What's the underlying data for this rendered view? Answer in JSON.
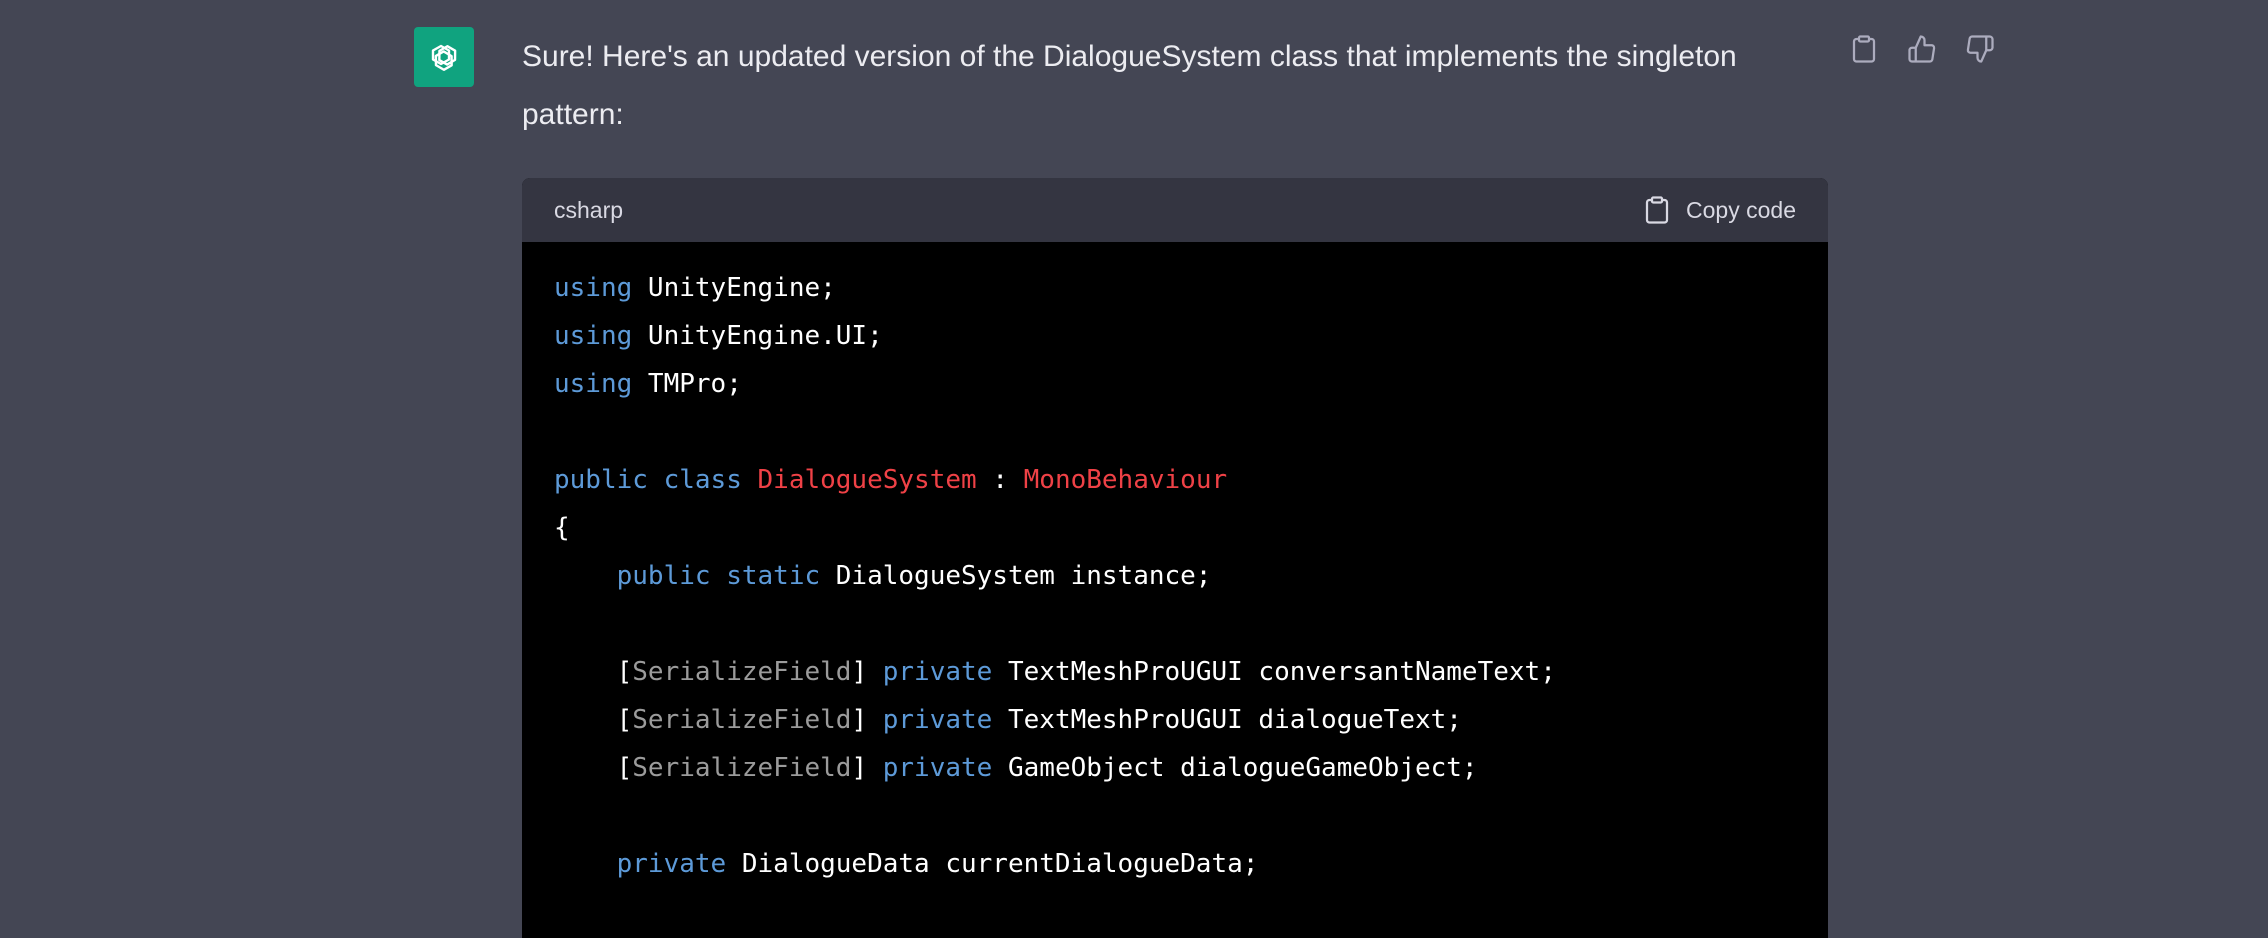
{
  "message": {
    "text": "Sure! Here's an updated version of the DialogueSystem class that implements the singleton pattern:"
  },
  "actions": {
    "copy_icon": "clipboard-icon",
    "like_icon": "thumbs-up-icon",
    "dislike_icon": "thumbs-down-icon"
  },
  "code": {
    "language": "csharp",
    "copy_label": "Copy code",
    "lines": [
      {
        "tokens": [
          {
            "t": "using",
            "c": "kw"
          },
          {
            "t": " UnityEngine;",
            "c": ""
          }
        ]
      },
      {
        "tokens": [
          {
            "t": "using",
            "c": "kw"
          },
          {
            "t": " UnityEngine.UI;",
            "c": ""
          }
        ]
      },
      {
        "tokens": [
          {
            "t": "using",
            "c": "kw"
          },
          {
            "t": " TMPro;",
            "c": ""
          }
        ]
      },
      {
        "tokens": []
      },
      {
        "tokens": [
          {
            "t": "public",
            "c": "kw"
          },
          {
            "t": " ",
            "c": ""
          },
          {
            "t": "class",
            "c": "kw"
          },
          {
            "t": " ",
            "c": ""
          },
          {
            "t": "DialogueSystem",
            "c": "cls"
          },
          {
            "t": " : ",
            "c": ""
          },
          {
            "t": "MonoBehaviour",
            "c": "cls"
          }
        ]
      },
      {
        "tokens": [
          {
            "t": "{",
            "c": ""
          }
        ]
      },
      {
        "tokens": [
          {
            "t": "    ",
            "c": ""
          },
          {
            "t": "public",
            "c": "kw"
          },
          {
            "t": " ",
            "c": ""
          },
          {
            "t": "static",
            "c": "kw"
          },
          {
            "t": " DialogueSystem instance;",
            "c": ""
          }
        ]
      },
      {
        "tokens": []
      },
      {
        "tokens": [
          {
            "t": "    [",
            "c": ""
          },
          {
            "t": "SerializeField",
            "c": "attr"
          },
          {
            "t": "] ",
            "c": ""
          },
          {
            "t": "private",
            "c": "kw"
          },
          {
            "t": " TextMeshProUGUI conversantNameText;",
            "c": ""
          }
        ]
      },
      {
        "tokens": [
          {
            "t": "    [",
            "c": ""
          },
          {
            "t": "SerializeField",
            "c": "attr"
          },
          {
            "t": "] ",
            "c": ""
          },
          {
            "t": "private",
            "c": "kw"
          },
          {
            "t": " TextMeshProUGUI dialogueText;",
            "c": ""
          }
        ]
      },
      {
        "tokens": [
          {
            "t": "    [",
            "c": ""
          },
          {
            "t": "SerializeField",
            "c": "attr"
          },
          {
            "t": "] ",
            "c": ""
          },
          {
            "t": "private",
            "c": "kw"
          },
          {
            "t": " GameObject dialogueGameObject;",
            "c": ""
          }
        ]
      },
      {
        "tokens": []
      },
      {
        "tokens": [
          {
            "t": "    ",
            "c": ""
          },
          {
            "t": "private",
            "c": "kw"
          },
          {
            "t": " DialogueData currentDialogueData;",
            "c": ""
          }
        ]
      }
    ]
  },
  "colors": {
    "background": "#444654",
    "avatar": "#10a37f",
    "keyword": "#5d9ad8",
    "class_name": "#ef4146",
    "attribute": "#9b9b9b",
    "code_background": "#000000",
    "code_header": "#343541"
  }
}
